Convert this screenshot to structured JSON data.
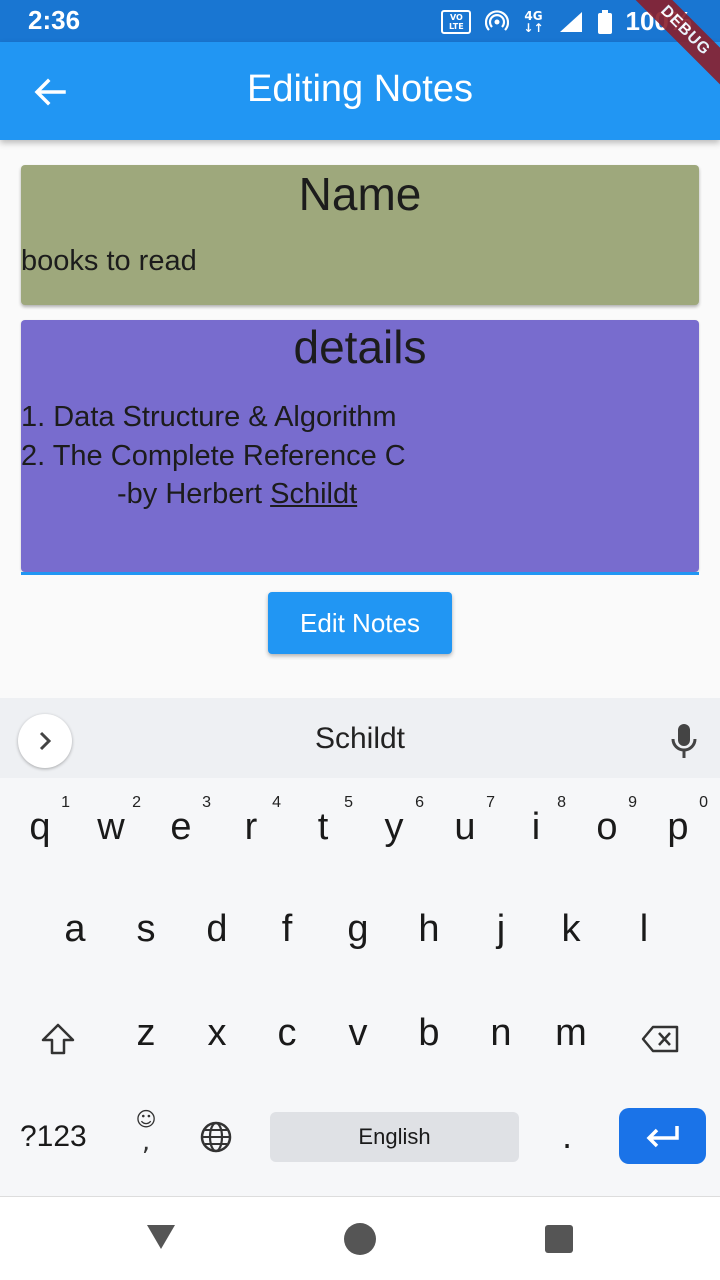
{
  "status_bar": {
    "time": "2:36",
    "volte_top": "VO",
    "volte_bottom": "LTE",
    "network": "4G",
    "battery": "100%"
  },
  "debug_banner": "DEBUG",
  "app_bar": {
    "title": "Editing Notes",
    "back_icon": "arrow-left-icon"
  },
  "name_card": {
    "label": "Name",
    "value": "books to read"
  },
  "details_card": {
    "label": "details",
    "line1": "1. Data Structure & Algorithm",
    "line2": "2. The Complete Reference C",
    "line3_prefix": "-by Herbert ",
    "line3_underlined": "Schildt"
  },
  "edit_button": "Edit Notes",
  "keyboard": {
    "suggestion": "Schildt",
    "row1": [
      {
        "key": "q",
        "hint": "1"
      },
      {
        "key": "w",
        "hint": "2"
      },
      {
        "key": "e",
        "hint": "3"
      },
      {
        "key": "r",
        "hint": "4"
      },
      {
        "key": "t",
        "hint": "5"
      },
      {
        "key": "y",
        "hint": "6"
      },
      {
        "key": "u",
        "hint": "7"
      },
      {
        "key": "i",
        "hint": "8"
      },
      {
        "key": "o",
        "hint": "9"
      },
      {
        "key": "p",
        "hint": "0"
      }
    ],
    "row2": [
      "a",
      "s",
      "d",
      "f",
      "g",
      "h",
      "j",
      "k",
      "l"
    ],
    "row3": [
      "z",
      "x",
      "c",
      "v",
      "b",
      "n",
      "m"
    ],
    "symbols_key": "?123",
    "emoji_comma": ",",
    "space_label": "English",
    "period": "."
  }
}
